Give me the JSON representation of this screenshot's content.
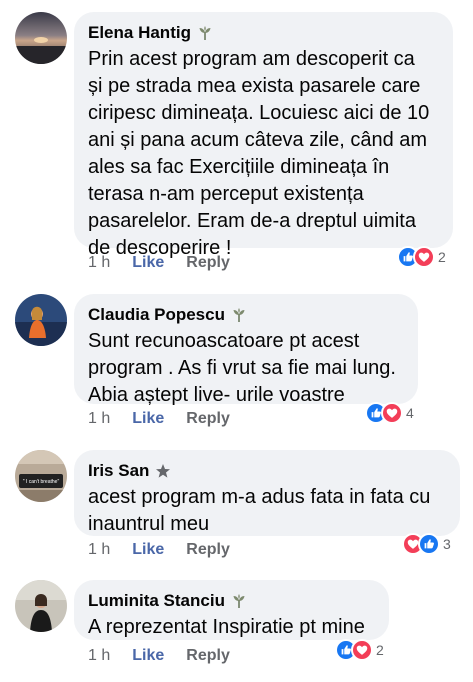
{
  "comments": [
    {
      "author": "Elena Hantig",
      "badge_icon": "top-fan-badge-icon",
      "text": "Prin acest program am descoperit ca\nși pe strada mea exista pasarele care\nciripesc dimineața. Locuiesc aici de 10\nani și pana acum câteva zile, când am\nales sa fac Exercițiile dimineața în\nterasa n-am perceput existența\npasarelelor. Eram de-a dreptul uimita\nde descoperire !",
      "time": "1 h",
      "like": "Like",
      "reply": "Reply",
      "reaction_count": "2",
      "reaction_order": [
        "like",
        "love"
      ]
    },
    {
      "author": "Claudia Popescu",
      "badge_icon": "top-fan-badge-icon",
      "text": "Sunt recunoascatoare pt acest\nprogram . As fi vrut sa fie mai lung.\nAbia aștept live- urile voastre",
      "time": "1 h",
      "like": "Like",
      "reply": "Reply",
      "reaction_count": "4",
      "reaction_order": [
        "like",
        "love"
      ]
    },
    {
      "author": "Iris San",
      "badge_icon": "star-badge-icon",
      "avatar_text": "\" I can't breathe\"",
      "text": "acest program m-a adus fata in fata cu\ninauntrul meu",
      "time": "1 h",
      "like": "Like",
      "reply": "Reply",
      "reaction_count": "3",
      "reaction_order": [
        "love",
        "like"
      ]
    },
    {
      "author": "Luminita Stanciu",
      "badge_icon": "top-fan-badge-icon",
      "text": "A reprezentat Inspiratie pt mine",
      "time": "1 h",
      "like": "Like",
      "reply": "Reply",
      "reaction_count": "2",
      "reaction_order": [
        "like",
        "love"
      ]
    }
  ],
  "colors": {
    "bubble": "#f0f2f5",
    "like_link": "#4a67a8",
    "meta": "#65676b",
    "react_like": "#1877f2",
    "react_love": "#f33e58"
  }
}
